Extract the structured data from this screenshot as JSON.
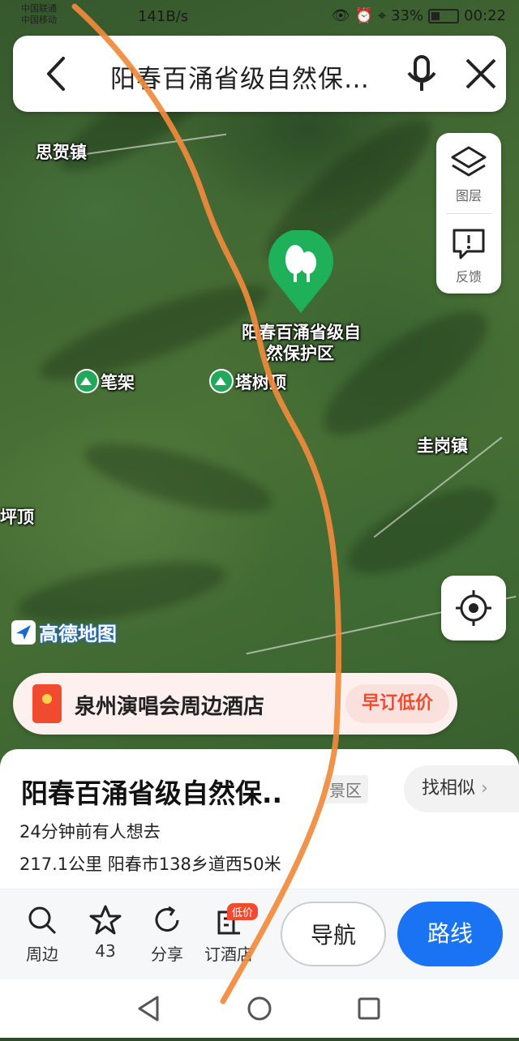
{
  "status_bar": {
    "carrier1": "中国联通",
    "carrier2": "中国移动",
    "net_speed": "141B/s",
    "battery": "33%",
    "time": "00:22"
  },
  "search": {
    "query": "阳春百涌省级自然保…",
    "icons": [
      "back-arrow-icon",
      "microphone-icon",
      "close-icon"
    ]
  },
  "map_tools": {
    "layers_label": "图层",
    "feedback_label": "反馈"
  },
  "map": {
    "labels": {
      "town1": "思贺镇",
      "poi_main_line1": "阳春百涌省级自",
      "poi_main_line2": "然保护区",
      "poi1": "笔架",
      "poi2": "塔树顶",
      "town2": "圭岗镇",
      "edge_label": "坪顶"
    },
    "logo_text": "高德地图",
    "accent_color": "#1fb05a"
  },
  "ad_banner": {
    "text": "泉州演唱会周边酒店",
    "cta": "早订低价"
  },
  "place": {
    "name": "阳春百涌省级自然保..",
    "category": "景区",
    "find_similar": "找相似",
    "visits": "24分钟前有人想去",
    "distance_address": "217.1公里  阳春市138乡道西50米"
  },
  "actions": {
    "nearby": "周边",
    "favorites_count": "43",
    "share": "分享",
    "hotel": "订酒店",
    "hotel_badge": "低价",
    "navigate": "导航",
    "route": "路线"
  },
  "colors": {
    "primary_blue": "#1a73f2",
    "promo_red": "#f04a2f"
  }
}
